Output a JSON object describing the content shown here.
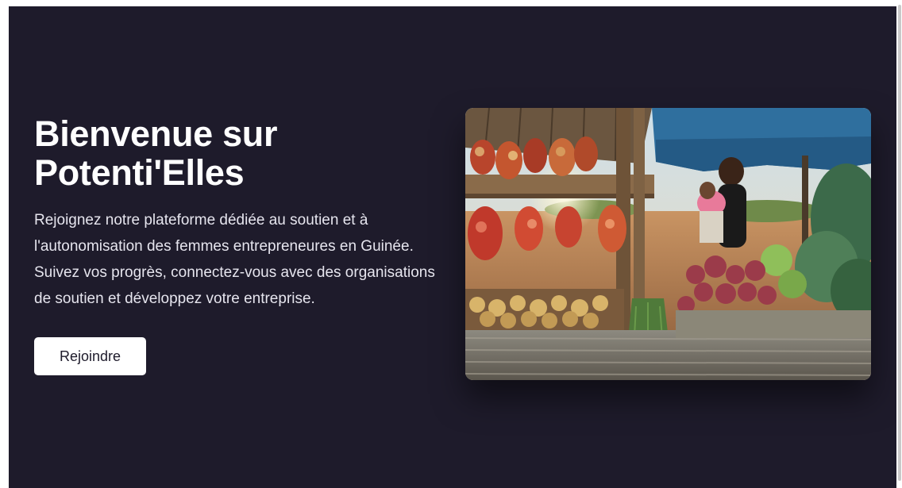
{
  "hero": {
    "title": "Bienvenue sur Potenti'Elles",
    "description": "Rejoignez notre plateforme dédiée au soutien et à l'autonomisation des femmes entrepreneures en Guinée. Suivez vos progrès, connectez-vous avec des organisations de soutien et développez votre entreprise.",
    "cta_label": "Rejoindre",
    "image_subject": "woman-vendor-at-market-stall-photo"
  },
  "colors": {
    "hero_background": "#1e1b2b",
    "button_background": "#ffffff",
    "button_text": "#1e1b2b",
    "title_text": "#ffffff"
  }
}
